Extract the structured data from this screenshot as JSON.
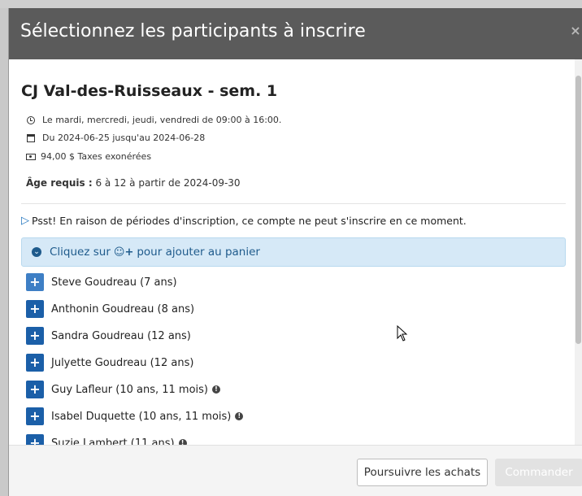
{
  "modal": {
    "title": "Sélectionnez les participants à inscrire",
    "close_label": "×"
  },
  "activity": {
    "title": "CJ Val-des-Ruisseaux - sem. 1",
    "schedule": "Le mardi, mercredi, jeudi, vendredi de 09:00 à 16:00.",
    "dates": "Du 2024-06-25 jusqu'au 2024-06-28",
    "price": "94,00 $ Taxes exonérées",
    "age_label": "Âge requis :",
    "age_value": "6 à 12 à partir de 2024-09-30"
  },
  "notice": {
    "psst": "Psst! En raison de périodes d'inscription, ce compte ne peut s'inscrire en ce moment."
  },
  "alert": {
    "prefix": "Cliquez sur",
    "suffix": "pour ajouter au panier"
  },
  "participants": [
    {
      "name": "Steve Goudreau (7 ans)",
      "has_info": false
    },
    {
      "name": "Anthonin Goudreau (8 ans)",
      "has_info": false
    },
    {
      "name": "Sandra Goudreau (12 ans)",
      "has_info": false
    },
    {
      "name": "Julyette Goudreau (12 ans)",
      "has_info": false
    },
    {
      "name": "Guy Lafleur (10 ans, 11 mois)",
      "has_info": true
    },
    {
      "name": "Isabel Duquette (10 ans, 11 mois)",
      "has_info": true
    },
    {
      "name": "Suzie Lambert (11 ans)",
      "has_info": true
    }
  ],
  "footer": {
    "continue_label": "Poursuivre les achats",
    "order_label": "Commander"
  },
  "colors": {
    "header_bg": "#5b5b5b",
    "add_button": "#1b5fa8",
    "alert_bg": "#d6e9f7",
    "alert_text": "#1f5b8c"
  },
  "icons": {
    "schedule": "clock-icon",
    "dates": "calendar-icon",
    "price": "money-icon",
    "notice": "bullhorn-icon",
    "alert": "circle-down-icon",
    "add_user": "user-plus-icon",
    "add": "plus-icon",
    "info": "info-icon"
  }
}
